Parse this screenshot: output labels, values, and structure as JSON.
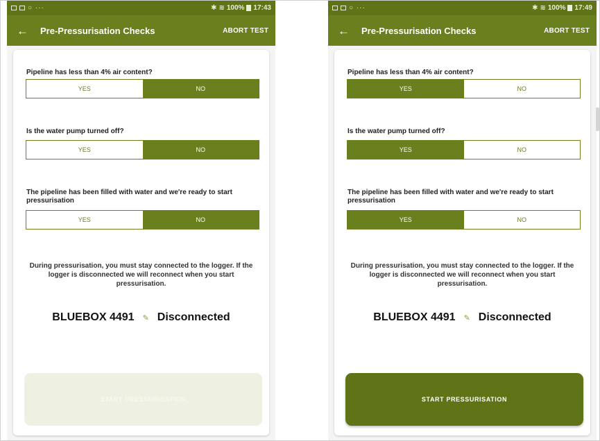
{
  "colors": {
    "primary": "#6a7f1d",
    "status_bar": "#5f7417",
    "disabled_button": "#eef1e1"
  },
  "screens": [
    {
      "status": {
        "signal": "100%",
        "time": "17:43"
      },
      "appbar": {
        "back_icon": "arrow-left-icon",
        "title": "Pre-Pressurisation Checks",
        "action": "ABORT TEST"
      },
      "questions": [
        {
          "text": "Pipeline has less than 4% air content?",
          "yes": "YES",
          "no": "NO",
          "selected": "NO"
        },
        {
          "text": "Is the water pump turned off?",
          "yes": "YES",
          "no": "NO",
          "selected": "NO"
        },
        {
          "text": "The pipeline has been filled with water and we're ready to start pressurisation",
          "yes": "YES",
          "no": "NO",
          "selected": "NO"
        }
      ],
      "info": "During pressurisation, you must stay connected to the logger.  If the logger is disconnected we will reconnect when you start pressurisation.",
      "logger": {
        "name": "BLUEBOX 4491",
        "icon": "bluetooth-icon",
        "status": "Disconnected"
      },
      "start_button": {
        "label": "START PRESSURISATION",
        "enabled": false
      }
    },
    {
      "status": {
        "signal": "100%",
        "time": "17:49"
      },
      "appbar": {
        "back_icon": "arrow-left-icon",
        "title": "Pre-Pressurisation Checks",
        "action": "ABORT TEST"
      },
      "questions": [
        {
          "text": "Pipeline has less than 4% air content?",
          "yes": "YES",
          "no": "NO",
          "selected": "YES"
        },
        {
          "text": "Is the water pump turned off?",
          "yes": "YES",
          "no": "NO",
          "selected": "YES"
        },
        {
          "text": "The pipeline has been filled with water and we're ready to start pressurisation",
          "yes": "YES",
          "no": "NO",
          "selected": "YES"
        }
      ],
      "info": "During pressurisation, you must stay connected to the logger.  If the logger is disconnected we will reconnect when you start pressurisation.",
      "logger": {
        "name": "BLUEBOX 4491",
        "icon": "bluetooth-icon",
        "status": "Disconnected"
      },
      "start_button": {
        "label": "START PRESSURISATION",
        "enabled": true
      }
    }
  ]
}
